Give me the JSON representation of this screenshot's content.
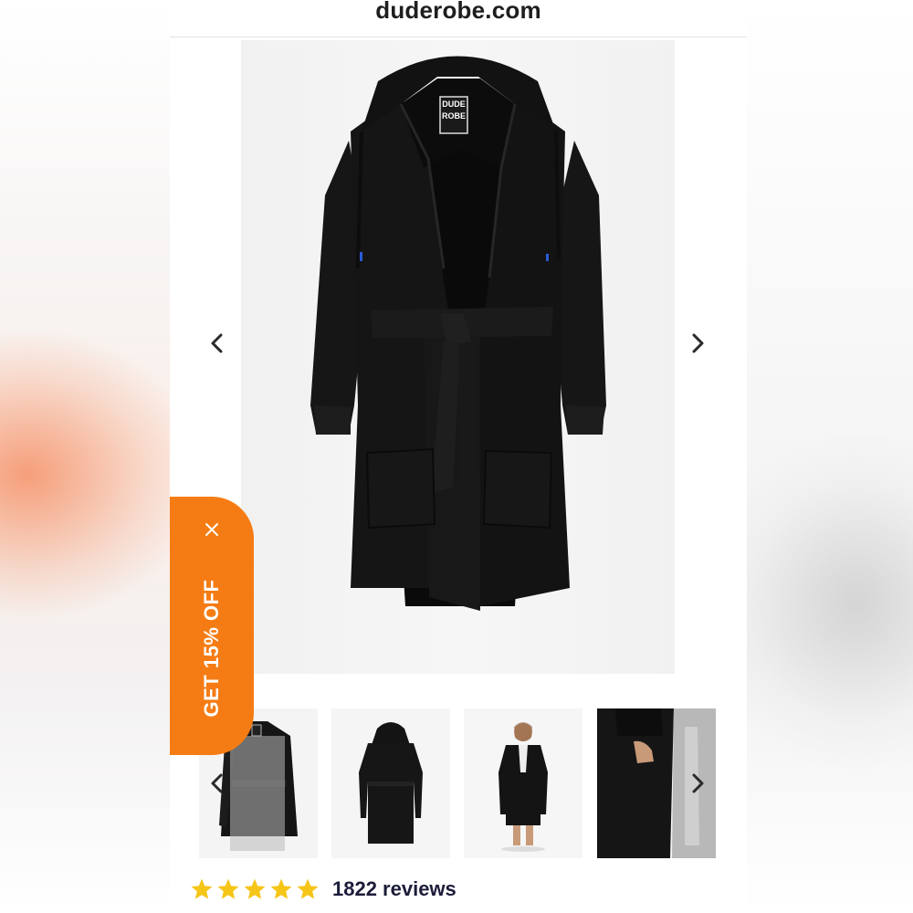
{
  "header": {
    "url": "duderobe.com"
  },
  "gallery": {
    "brand_label_line1": "DUDE",
    "brand_label_line2": "ROBE",
    "thumbnails": [
      "robe-front-thumbnail",
      "robe-back-thumbnail",
      "model-wearing-robe-thumbnail",
      "robe-pocket-closeup-thumbnail"
    ]
  },
  "promo": {
    "label": "GET 15% OFF"
  },
  "reviews": {
    "stars": 5,
    "count_label": "1822 reviews",
    "star_color": "#f5c518"
  },
  "colors": {
    "accent": "#f57c14",
    "robe": "#141414"
  }
}
